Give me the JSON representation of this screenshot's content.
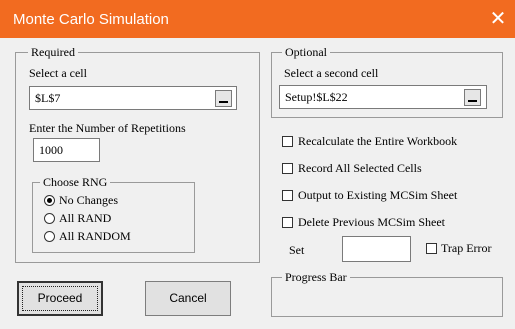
{
  "window": {
    "title": "Monte Carlo Simulation",
    "close_icon": "close-icon"
  },
  "required": {
    "legend": "Required",
    "select_cell_label": "Select a cell",
    "cell_value": "$L$7",
    "repetitions_label": "Enter the Number of Repetitions",
    "repetitions_value": "1000",
    "rng": {
      "legend": "Choose RNG",
      "options": [
        {
          "label": "No Changes",
          "selected": true
        },
        {
          "label": "All RAND",
          "selected": false
        },
        {
          "label": "All RANDOM",
          "selected": false
        }
      ]
    }
  },
  "optional": {
    "legend": "Optional",
    "second_cell_label": "Select a second cell",
    "second_cell_value": "Setup!$L$22"
  },
  "options": {
    "recalculate": "Recalculate the Entire Workbook",
    "record_all": "Record All Selected Cells",
    "output_existing": "Output to Existing MCSim Sheet",
    "delete_previous": "Delete Previous MCSim Sheet",
    "set_label": "Set",
    "set_value": "",
    "trap_error": "Trap Error"
  },
  "progress": {
    "legend": "Progress Bar"
  },
  "buttons": {
    "proceed": "Proceed",
    "cancel": "Cancel"
  },
  "colors": {
    "titlebar": "#f26b20",
    "dialog_bg": "#f0f0f0"
  }
}
